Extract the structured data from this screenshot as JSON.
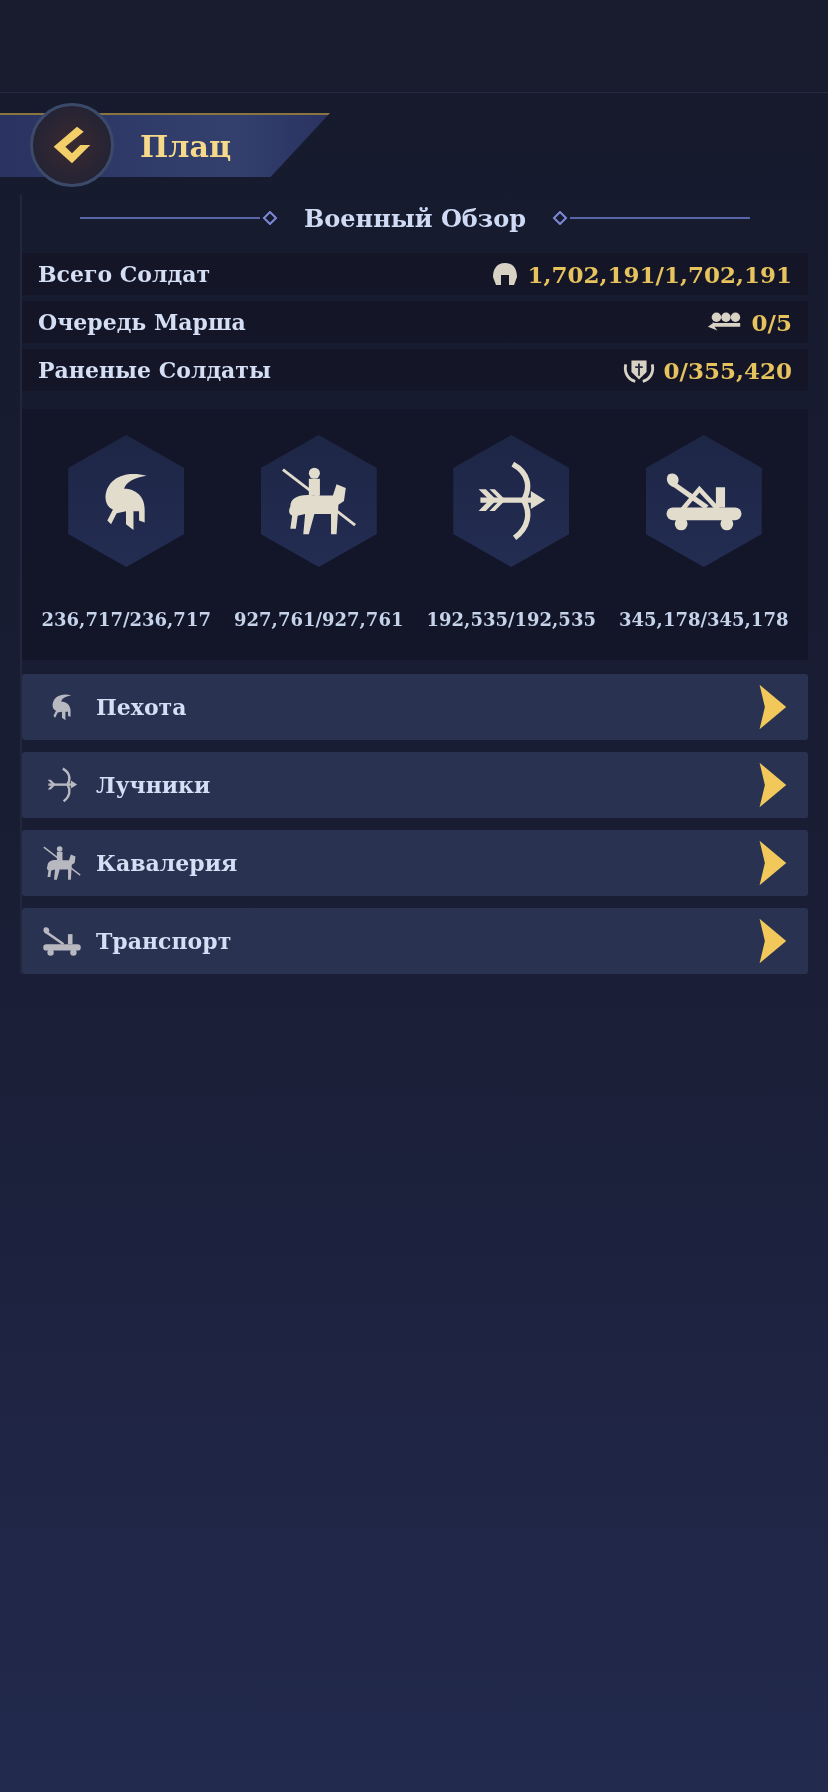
{
  "header": {
    "title": "Плац"
  },
  "overview": {
    "title": "Военный Обзор",
    "stats": [
      {
        "kind": "soldiers",
        "label": "Всего Солдат",
        "value": "1,702,191/1,702,191"
      },
      {
        "kind": "march",
        "label": "Очередь Марша",
        "value": "0/5"
      },
      {
        "kind": "wounded",
        "label": "Раненые Солдаты",
        "value": "0/355,420"
      }
    ]
  },
  "units": [
    {
      "kind": "infantry",
      "count": "236,717/236,717"
    },
    {
      "kind": "cavalry",
      "count": "927,761/927,761"
    },
    {
      "kind": "archer",
      "count": "192,535/192,535"
    },
    {
      "kind": "siege",
      "count": "345,178/345,178"
    }
  ],
  "categories": [
    {
      "kind": "infantry",
      "label": "Пехота"
    },
    {
      "kind": "archer",
      "label": "Лучники"
    },
    {
      "kind": "cavalry",
      "label": "Кавалерия"
    },
    {
      "kind": "siege",
      "label": "Транспорт"
    }
  ]
}
